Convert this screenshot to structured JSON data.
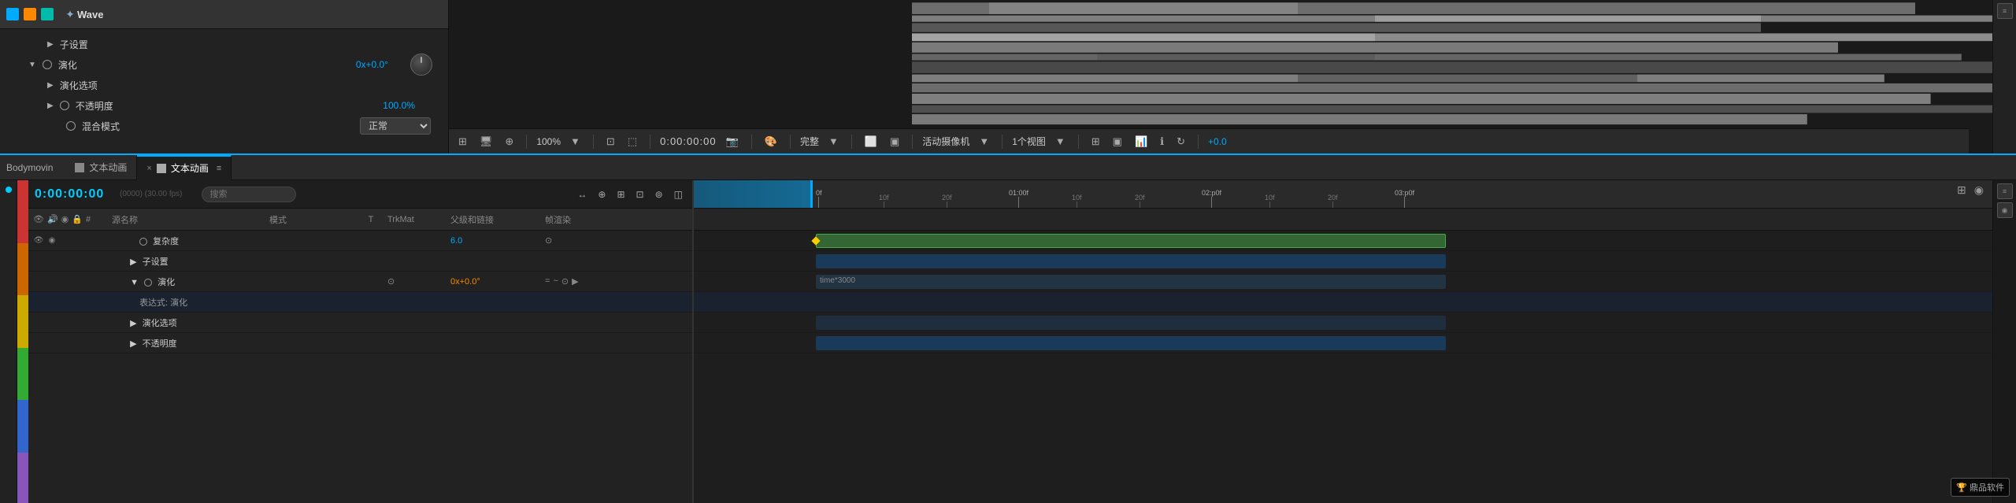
{
  "app": {
    "title": "Wave",
    "brand": "Bodymovin"
  },
  "top_layer": {
    "name": "Wave",
    "icons": [
      "blue",
      "orange",
      "teal"
    ],
    "tool": "✦"
  },
  "layer_properties": {
    "items": [
      {
        "indent": 1,
        "type": "triangle",
        "label": "子设置",
        "value": ""
      },
      {
        "indent": 1,
        "type": "circle_triangle",
        "label": "演化",
        "value": "0x+0.0°",
        "has_knob": true
      },
      {
        "indent": 2,
        "type": "triangle",
        "label": "演化选项",
        "value": ""
      },
      {
        "indent": 2,
        "type": "circle",
        "label": "不透明度",
        "value": "100.0%"
      },
      {
        "indent": 2,
        "type": "circle",
        "label": "混合模式",
        "value": "正常",
        "is_dropdown": true
      }
    ]
  },
  "preview_toolbar": {
    "zoom": "100%",
    "timecode": "0:00:00:00",
    "quality": "完整",
    "camera": "活动摄像机",
    "view": "1个视图",
    "offset": "+0.0",
    "icons": [
      "grid-icon",
      "screen-icon",
      "mask-icon",
      "camera-icon",
      "color-icon",
      "quality-icon"
    ]
  },
  "tabs": [
    {
      "label": "文本动画",
      "active": false
    },
    {
      "label": "文本动画",
      "active": true
    }
  ],
  "timeline": {
    "timecode": "0:00:00:00",
    "timecode_sub": "(0000) (30.00 fps)",
    "search_placeholder": "搜索",
    "columns": {
      "icons": "",
      "name": "源名称",
      "mode": "模式",
      "t": "T",
      "trkmat": "TrkMat",
      "parent": "父级和链接",
      "extra": "帧渲染"
    },
    "layers": [
      {
        "name": "复杂度",
        "indent": 2,
        "mode": "",
        "parent_value": "6.0",
        "parent_color": "cyan",
        "type": "circle",
        "extra_icon": "⊙"
      },
      {
        "name": "子设置",
        "indent": 2,
        "triangle": true,
        "mode": "",
        "parent_value": "",
        "type": "triangle"
      },
      {
        "name": "演化",
        "indent": 2,
        "triangle": true,
        "circle": true,
        "mode": "",
        "parent_value": "0x+0.0°",
        "parent_color": "orange",
        "has_extra": true,
        "extra": [
          "=",
          "~",
          "⊙",
          "▶"
        ],
        "type": "circle_triangle",
        "extra_icon": "⊙"
      },
      {
        "name": "表达式: 演化",
        "indent": 3,
        "mode": "",
        "parent_value": "",
        "type": "expression"
      },
      {
        "name": "演化选项",
        "indent": 2,
        "triangle": true,
        "mode": "",
        "parent_value": "",
        "type": "triangle"
      },
      {
        "name": "不透明度",
        "indent": 2,
        "circle": true,
        "mode": "",
        "parent_value": "",
        "type": "circle"
      }
    ]
  },
  "timeline_ruler": {
    "markers": [
      "0f",
      "10f",
      "20f",
      "01:00f",
      "10f",
      "20f",
      "02:p0f",
      "10f",
      "20f",
      "03:p0f"
    ],
    "positions": [
      0,
      80,
      160,
      280,
      360,
      440,
      560,
      640,
      720,
      840
    ]
  },
  "track_data": {
    "playhead_width": 150,
    "label": "time*3000"
  },
  "colors": {
    "accent_blue": "#00aaff",
    "accent_orange": "#ff8800",
    "text_cyan": "#00ccff",
    "bg_dark": "#1e1e1e",
    "bg_medium": "#2a2a2a",
    "bg_light": "#333333"
  },
  "watermark": {
    "label": "鼎品软件"
  },
  "color_bars": [
    "#ff3333",
    "#ff6600",
    "#ffcc00",
    "#33cc33",
    "#3399ff",
    "#9966cc"
  ],
  "expression_label": "time*3000"
}
